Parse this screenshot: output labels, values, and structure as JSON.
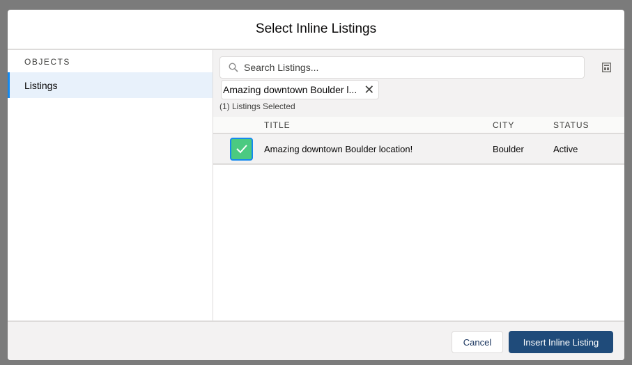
{
  "modal": {
    "title": "Select Inline Listings"
  },
  "sidebar": {
    "heading": "OBJECTS",
    "items": [
      {
        "label": "Listings",
        "selected": true
      }
    ]
  },
  "search": {
    "placeholder": "Search Listings...",
    "value": ""
  },
  "selected_pill": {
    "label": "Amazing downtown Boulder l..."
  },
  "selection_count": "(1) Listings Selected",
  "table": {
    "columns": [
      "TITLE",
      "CITY",
      "STATUS"
    ],
    "rows": [
      {
        "checked": true,
        "title": "Amazing downtown Boulder location!",
        "city": "Boulder",
        "status": "Active"
      }
    ]
  },
  "footer": {
    "cancel_label": "Cancel",
    "insert_label": "Insert Inline Listing"
  },
  "colors": {
    "accent": "#1589ee",
    "check": "#4bca81",
    "brand_button": "#1f4b7a"
  },
  "icons": {
    "search": "search-icon",
    "calculator": "calculator-icon",
    "remove": "close-icon",
    "check": "checkmark-icon"
  }
}
